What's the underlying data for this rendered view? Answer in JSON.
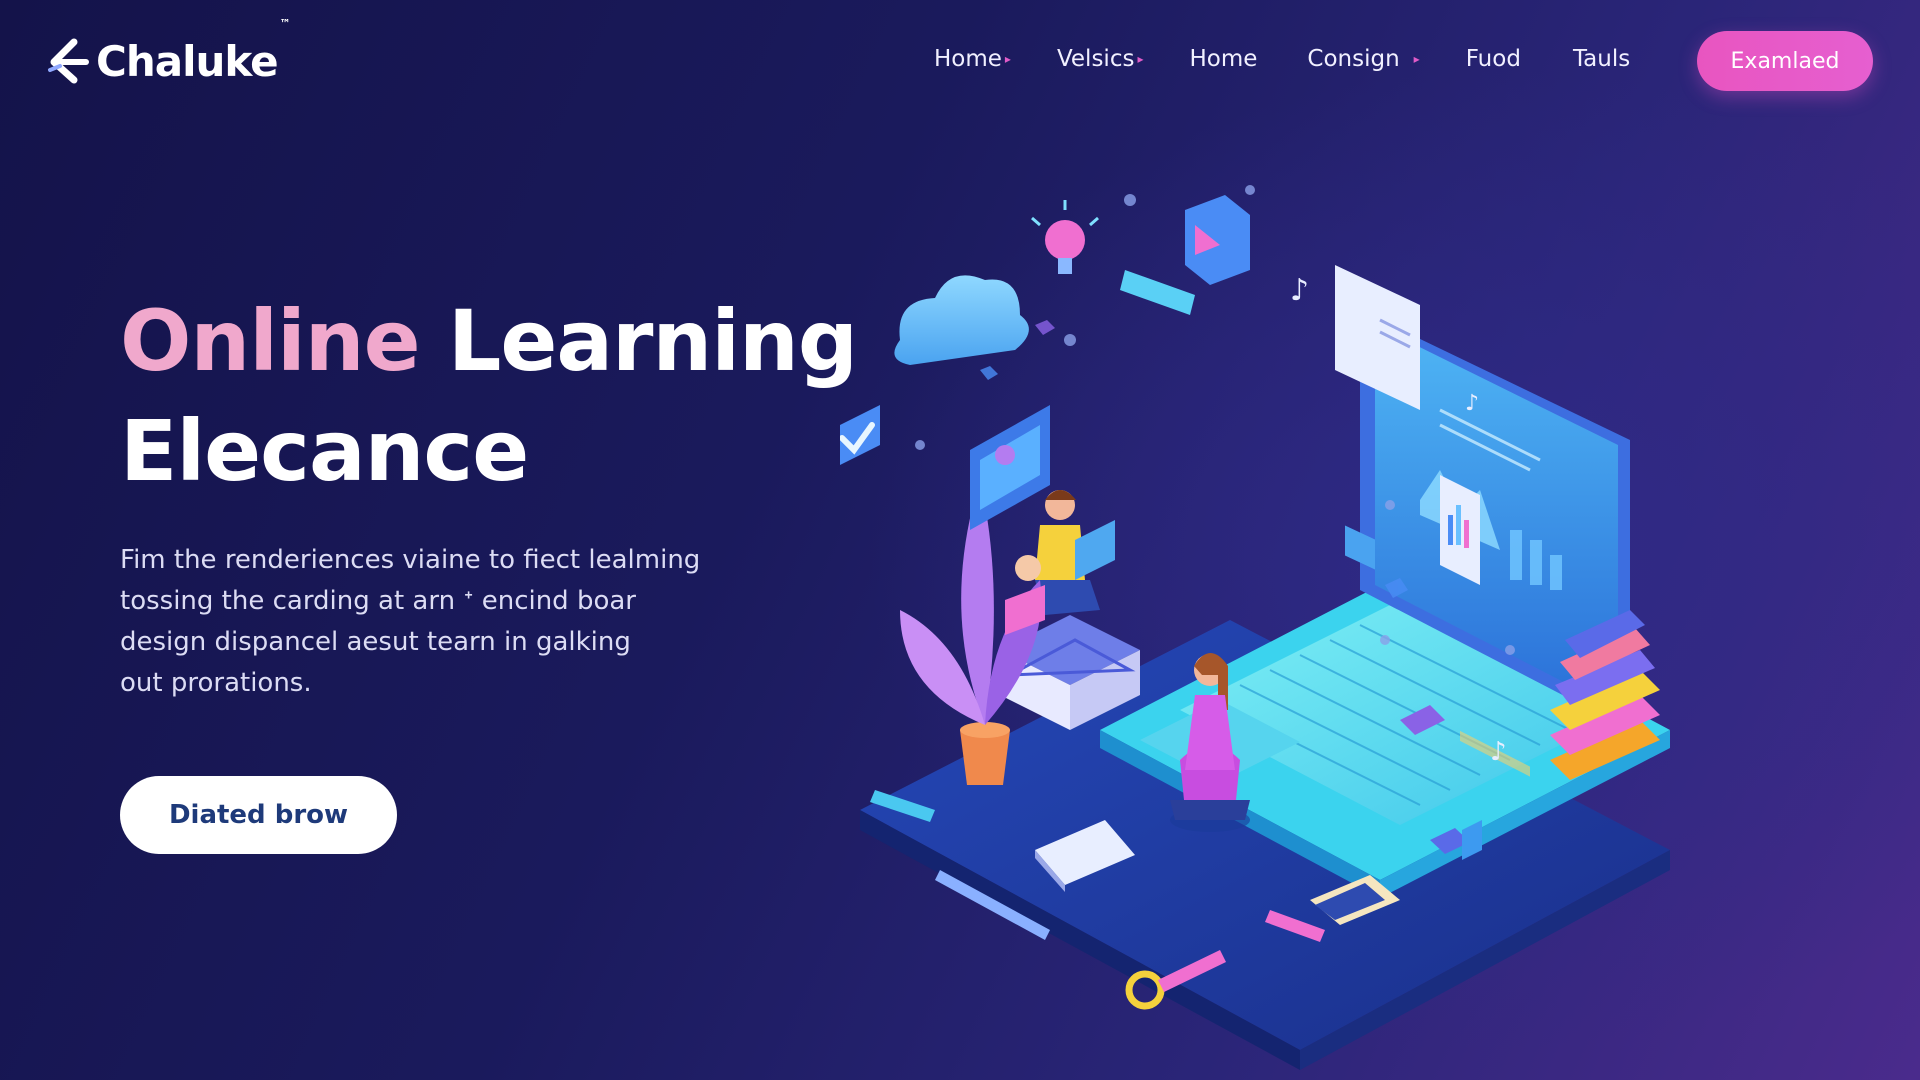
{
  "brand": {
    "name": "Chaluke",
    "tm": "™"
  },
  "nav": {
    "items": [
      {
        "label": "Home",
        "has_arrow": true
      },
      {
        "label": "Velsics",
        "has_arrow": true
      },
      {
        "label": "Home",
        "has_arrow": false
      },
      {
        "label": "Consign",
        "has_arrow": true
      },
      {
        "label": "Fuod",
        "has_arrow": false
      },
      {
        "label": "Tauls",
        "has_arrow": false
      }
    ],
    "arrow_glyph": "▸",
    "cta_label": "Examlaed"
  },
  "hero": {
    "title_accent": "Online",
    "title_rest_line1": "Learning",
    "title_line2": "Elecance",
    "description_lines": [
      "Fim the renderiences viaine to fiect lealming",
      "tossing the carding at arn ᐩ encind boar",
      "design dispancel aesut tearn in galking",
      "out prorations."
    ],
    "button_label": "Diated brow"
  },
  "colors": {
    "accent_pink": "#e855c0",
    "title_accent": "#f0a8cc",
    "button_text": "#1e3a7a",
    "background_dark": "#14134a"
  },
  "illustration": {
    "icon": "online-learning-isometric-illustration"
  }
}
